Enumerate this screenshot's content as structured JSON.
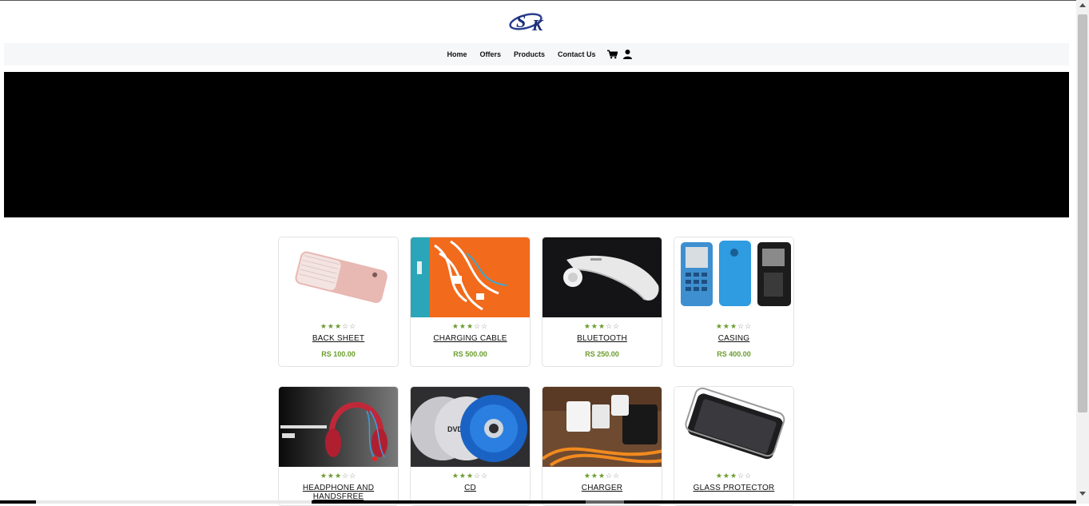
{
  "nav": {
    "logo_text": "SK",
    "links": [
      "Home",
      "Offers",
      "Products",
      "Contact Us"
    ]
  },
  "rating": {
    "filled": 3,
    "total": 5
  },
  "products": [
    {
      "name": "BACK SHEET",
      "price": "RS 100.00"
    },
    {
      "name": "CHARGING CABLE",
      "price": "RS 500.00"
    },
    {
      "name": "BLUETOOTH",
      "price": "RS 250.00"
    },
    {
      "name": "CASING",
      "price": "RS 400.00"
    },
    {
      "name": "HEADPHONE AND HANDSFREE",
      "price": ""
    },
    {
      "name": "CD",
      "price": ""
    },
    {
      "name": "CHARGER",
      "price": ""
    },
    {
      "name": "GLASS PROTECTOR",
      "price": ""
    }
  ],
  "colors": {
    "accent_green": "#6a9c2c",
    "nav_bg": "#f6f7f9",
    "banner": "#000000"
  }
}
